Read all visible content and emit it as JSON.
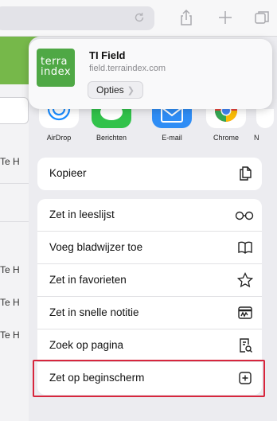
{
  "toolbar": {
    "reload_icon": "reload-icon",
    "share_icon": "share-icon",
    "new_tab_icon": "plus-icon",
    "tabs_icon": "tabs-icon"
  },
  "background": {
    "row_text": "Te H"
  },
  "share_sheet": {
    "app": {
      "logo_line1": "terra",
      "logo_line2": "index",
      "title": "TI Field",
      "url": "field.terraindex.com",
      "options_label": "Opties"
    },
    "targets": [
      {
        "label": "AirDrop",
        "icon": "airdrop-icon",
        "color": "#1a8cff"
      },
      {
        "label": "Berichten",
        "icon": "messages-icon",
        "color": "#31c24a"
      },
      {
        "label": "E-mail",
        "icon": "mail-icon",
        "color": "#2f8df5"
      },
      {
        "label": "Chrome",
        "icon": "chrome-icon",
        "color": "#e8453c"
      },
      {
        "label": "N",
        "icon": "more-app-icon",
        "color": "#cccccc"
      }
    ],
    "group1": [
      {
        "label": "Kopieer",
        "icon": "copy-icon"
      }
    ],
    "group2": [
      {
        "label": "Zet in leeslijst",
        "icon": "glasses-icon"
      },
      {
        "label": "Voeg bladwijzer toe",
        "icon": "book-icon"
      },
      {
        "label": "Zet in favorieten",
        "icon": "star-icon"
      },
      {
        "label": "Zet in snelle notitie",
        "icon": "quick-note-icon"
      },
      {
        "label": "Zoek op pagina",
        "icon": "find-in-page-icon"
      },
      {
        "label": "Zet op beginscherm",
        "icon": "add-square-icon"
      }
    ]
  },
  "highlight_color": "#d7263d"
}
